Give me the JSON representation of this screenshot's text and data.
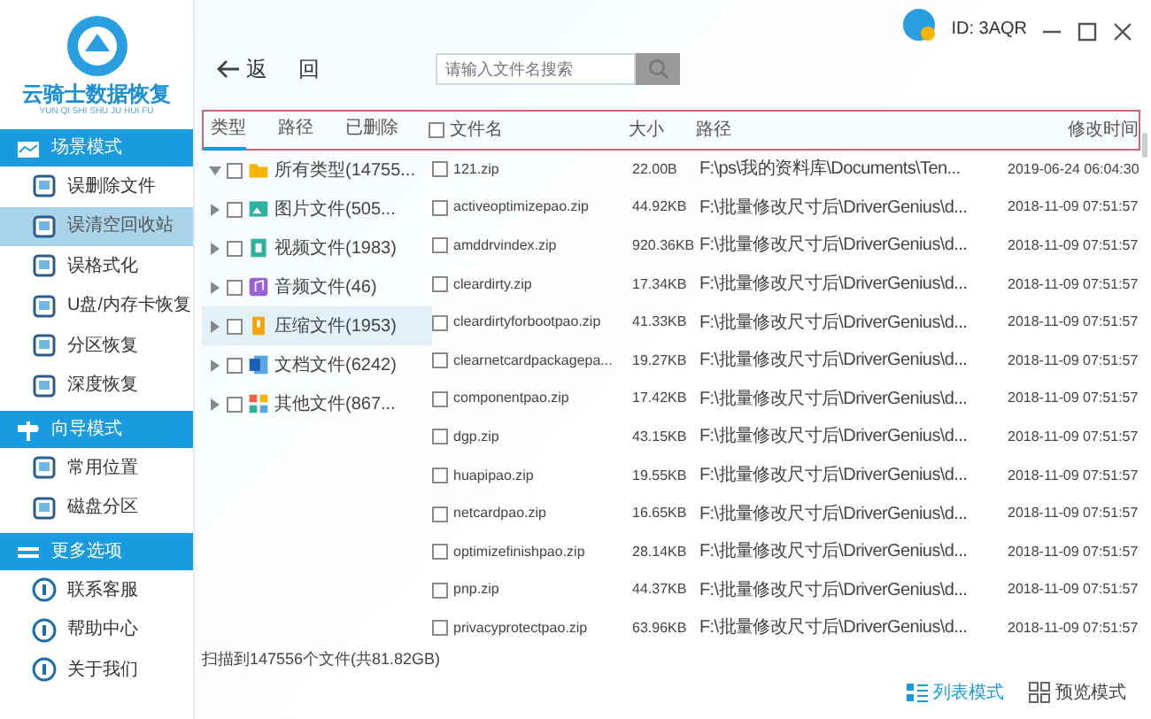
{
  "brand": {
    "name": "云骑士数据恢复",
    "pinyin": "YUN QI SHI SHU JU HUI FU"
  },
  "sidebar": {
    "sections": [
      {
        "title": "场景模式",
        "items": [
          {
            "label": "误删除文件",
            "selected": false
          },
          {
            "label": "误清空回收站",
            "selected": true
          },
          {
            "label": "误格式化",
            "selected": false
          },
          {
            "label": "U盘/内存卡恢复",
            "selected": false
          },
          {
            "label": "分区恢复",
            "selected": false
          },
          {
            "label": "深度恢复",
            "selected": false
          }
        ]
      },
      {
        "title": "向导模式",
        "items": [
          {
            "label": "常用位置",
            "selected": false
          },
          {
            "label": "磁盘分区",
            "selected": false
          }
        ]
      },
      {
        "title": "更多选项",
        "items": [
          {
            "label": "联系客服",
            "selected": false
          },
          {
            "label": "帮助中心",
            "selected": false
          },
          {
            "label": "关于我们",
            "selected": false
          }
        ]
      }
    ]
  },
  "titlebar": {
    "user_id": "ID: 3AQR"
  },
  "toolbar": {
    "back_label": "返 回",
    "search": {
      "placeholder": "请输入文件名搜索"
    }
  },
  "filter_tabs": [
    {
      "label": "类型",
      "selected": true
    },
    {
      "label": "路径",
      "selected": false
    },
    {
      "label": "已删除",
      "selected": false
    }
  ],
  "table": {
    "select_all_checked": false,
    "columns": [
      "文件名",
      "大小",
      "路径",
      "修改时间"
    ],
    "rows": [
      {
        "name": "121.zip",
        "size": "22.00B",
        "path": "F:\\ps\\我的资料库\\Documents\\Ten...",
        "modified": "2019-06-24 06:04:30",
        "checked": false
      },
      {
        "name": "activeoptimizepao.zip",
        "size": "44.92KB",
        "path": "F:\\批量修改尺寸后\\DriverGenius\\d...",
        "modified": "2018-11-09 07:51:57",
        "checked": false
      },
      {
        "name": "amddrvindex.zip",
        "size": "920.36KB",
        "path": "F:\\批量修改尺寸后\\DriverGenius\\d...",
        "modified": "2018-11-09 07:51:57",
        "checked": false
      },
      {
        "name": "cleardirty.zip",
        "size": "17.34KB",
        "path": "F:\\批量修改尺寸后\\DriverGenius\\d...",
        "modified": "2018-11-09 07:51:57",
        "checked": false
      },
      {
        "name": "cleardirtyforbootpao.zip",
        "size": "41.33KB",
        "path": "F:\\批量修改尺寸后\\DriverGenius\\d...",
        "modified": "2018-11-09 07:51:57",
        "checked": false
      },
      {
        "name": "clearnetcardpackagepa...",
        "size": "19.27KB",
        "path": "F:\\批量修改尺寸后\\DriverGenius\\d...",
        "modified": "2018-11-09 07:51:57",
        "checked": false
      },
      {
        "name": "componentpao.zip",
        "size": "17.42KB",
        "path": "F:\\批量修改尺寸后\\DriverGenius\\d...",
        "modified": "2018-11-09 07:51:57",
        "checked": false
      },
      {
        "name": "dgp.zip",
        "size": "43.15KB",
        "path": "F:\\批量修改尺寸后\\DriverGenius\\d...",
        "modified": "2018-11-09 07:51:57",
        "checked": false
      },
      {
        "name": "huapipao.zip",
        "size": "19.55KB",
        "path": "F:\\批量修改尺寸后\\DriverGenius\\d...",
        "modified": "2018-11-09 07:51:57",
        "checked": false
      },
      {
        "name": "netcardpao.zip",
        "size": "16.65KB",
        "path": "F:\\批量修改尺寸后\\DriverGenius\\d...",
        "modified": "2018-11-09 07:51:57",
        "checked": false
      },
      {
        "name": "optimizefinishpao.zip",
        "size": "28.14KB",
        "path": "F:\\批量修改尺寸后\\DriverGenius\\d...",
        "modified": "2018-11-09 07:51:57",
        "checked": false
      },
      {
        "name": "pnp.zip",
        "size": "44.37KB",
        "path": "F:\\批量修改尺寸后\\DriverGenius\\d...",
        "modified": "2018-11-09 07:51:57",
        "checked": false
      },
      {
        "name": "privacyprotectpao.zip",
        "size": "63.96KB",
        "path": "F:\\批量修改尺寸后\\DriverGenius\\d...",
        "modified": "2018-11-09 07:51:57",
        "checked": false
      }
    ]
  },
  "tree": [
    {
      "label": "所有类型(14755...",
      "kind": "folder",
      "expanded": true,
      "checked": false,
      "selected": false,
      "children": [
        {
          "label": "图片文件(505...",
          "kind": "image",
          "expanded": false,
          "checked": false,
          "selected": false
        },
        {
          "label": "视频文件(1983)",
          "kind": "video",
          "expanded": false,
          "checked": false,
          "selected": false
        },
        {
          "label": "音频文件(46)",
          "kind": "audio",
          "expanded": false,
          "checked": false,
          "selected": false
        },
        {
          "label": "压缩文件(1953)",
          "kind": "archive",
          "expanded": false,
          "checked": false,
          "selected": true
        },
        {
          "label": "文档文件(6242)",
          "kind": "document",
          "expanded": false,
          "checked": false,
          "selected": false
        },
        {
          "label": "其他文件(867...",
          "kind": "other",
          "expanded": false,
          "checked": false,
          "selected": false
        }
      ]
    }
  ],
  "status": "扫描到147556个文件(共81.82GB)",
  "view_modes": [
    {
      "label": "列表模式",
      "selected": true
    },
    {
      "label": "预览模式",
      "selected": false
    }
  ]
}
